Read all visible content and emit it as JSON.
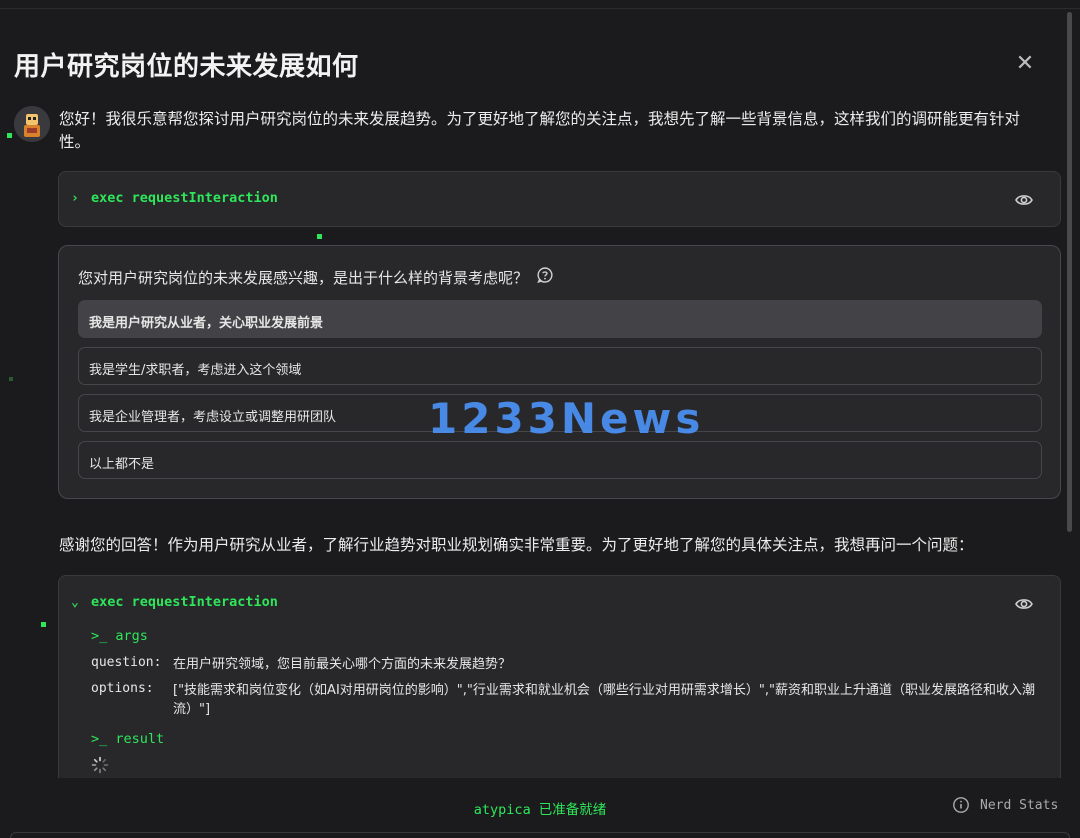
{
  "dialog": {
    "title": "用户研究岗位的未来发展如何",
    "close_icon": "✕"
  },
  "messages": {
    "first": "您好！我很乐意帮您探讨用户研究岗位的未来发展趋势。为了更好地了解您的关注点，我想先了解一些背景信息，这样我们的调研能更有针对性。",
    "second": "感谢您的回答！作为用户研究从业者，了解行业趋势对职业规划确实非常重要。为了更好地了解您的具体关注点，我想再问一个问题："
  },
  "tool_calls": [
    {
      "label": "exec requestInteraction",
      "state": "collapsed"
    },
    {
      "label": "exec requestInteraction",
      "state": "expanded"
    }
  ],
  "question_card": {
    "question": "您对用户研究岗位的未来发展感兴趣，是出于什么样的背景考虑呢？",
    "options": [
      {
        "label": "我是用户研究从业者，关心职业发展前景",
        "selected": true
      },
      {
        "label": "我是学生/求职者，考虑进入这个领域",
        "selected": false
      },
      {
        "label": "我是企业管理者，考虑设立或调整用研团队",
        "selected": false
      },
      {
        "label": "以上都不是",
        "selected": false
      }
    ]
  },
  "tool_detail": {
    "args_label": ">_ args",
    "question_key": "question:",
    "question_value": "在用户研究领域，您目前最关心哪个方面的未来发展趋势？",
    "options_key": "options:",
    "options_value": "[\"技能需求和岗位变化（如AI对用研岗位的影响）\",\"行业需求和就业机会（哪些行业对用研需求增长）\",\"薪资和职业上升通道（职业发展路径和收入潮流）\"]",
    "result_label": ">_ result"
  },
  "footer": {
    "app_name": "atypica",
    "status": "已准备就绪",
    "nerd_stats": "Nerd Stats"
  },
  "watermark": "1233News",
  "colors": {
    "background": "#1b1b1d",
    "panel": "#28282b",
    "accent_green": "#2ee65a",
    "watermark_blue": "#4a8ff0"
  }
}
